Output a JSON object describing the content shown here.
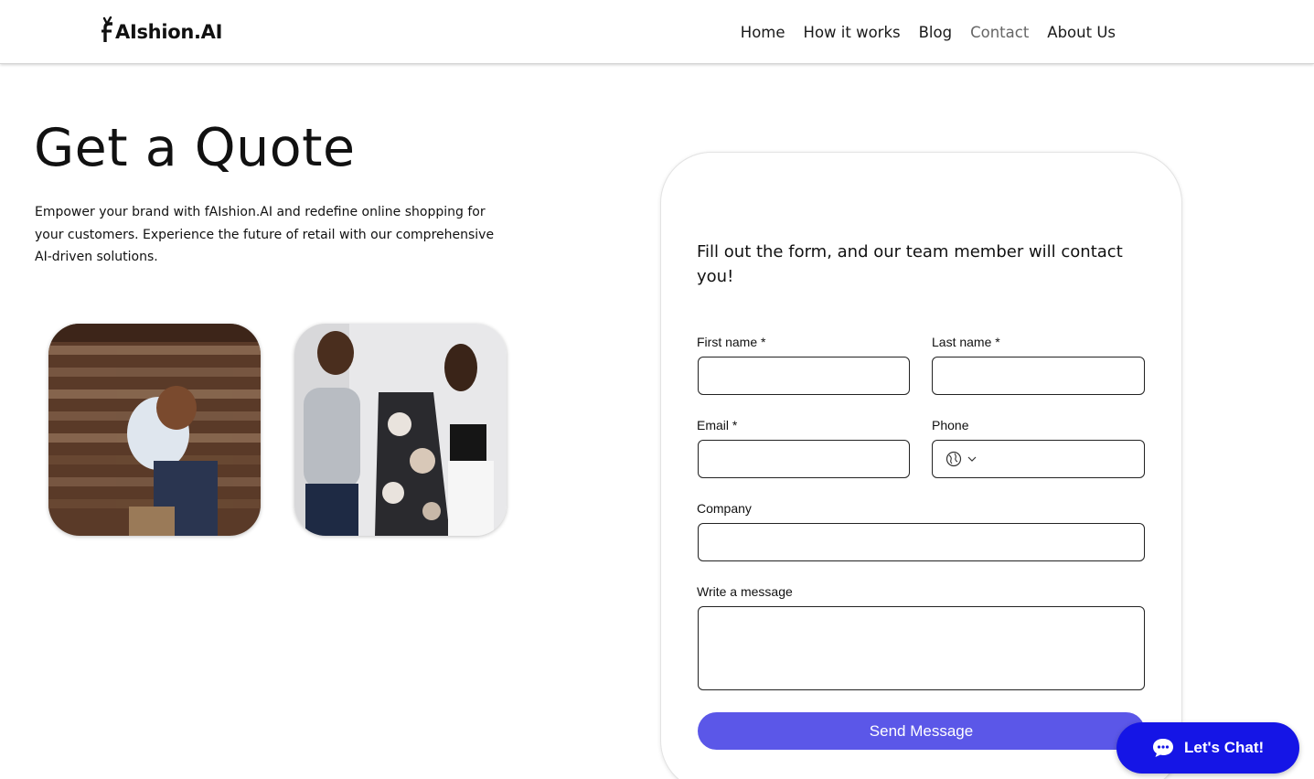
{
  "header": {
    "logo_text": "AIshion.AI",
    "nav": [
      {
        "label": "Home"
      },
      {
        "label": "How it works"
      },
      {
        "label": "Blog"
      },
      {
        "label": "Contact"
      },
      {
        "label": "About Us"
      }
    ],
    "active_nav": "Contact"
  },
  "hero": {
    "title": "Get a Quote",
    "intro": "Empower your brand with fAIshion.AI and redefine online shopping for your customers. Experience the future of retail with our comprehensive AI-driven solutions."
  },
  "form": {
    "heading": "Fill out the form, and our team member will contact you!",
    "first_name_label": "First name *",
    "last_name_label": "Last name *",
    "email_label": "Email *",
    "phone_label": "Phone",
    "company_label": "Company",
    "message_label": "Write a message",
    "first_name_value": "",
    "last_name_value": "",
    "email_value": "",
    "phone_value": "",
    "company_value": "",
    "message_value": "",
    "submit_label": "Send Message"
  },
  "chat": {
    "label": "Let's Chat!"
  },
  "colors": {
    "accent": "#5b57e8",
    "chat": "#1515e6",
    "text": "#111111"
  },
  "icons": {
    "globe": "globe-icon",
    "chevron": "chevron-down-icon",
    "chat": "chat-bubble-icon",
    "logo": "hanger-logo-icon"
  }
}
